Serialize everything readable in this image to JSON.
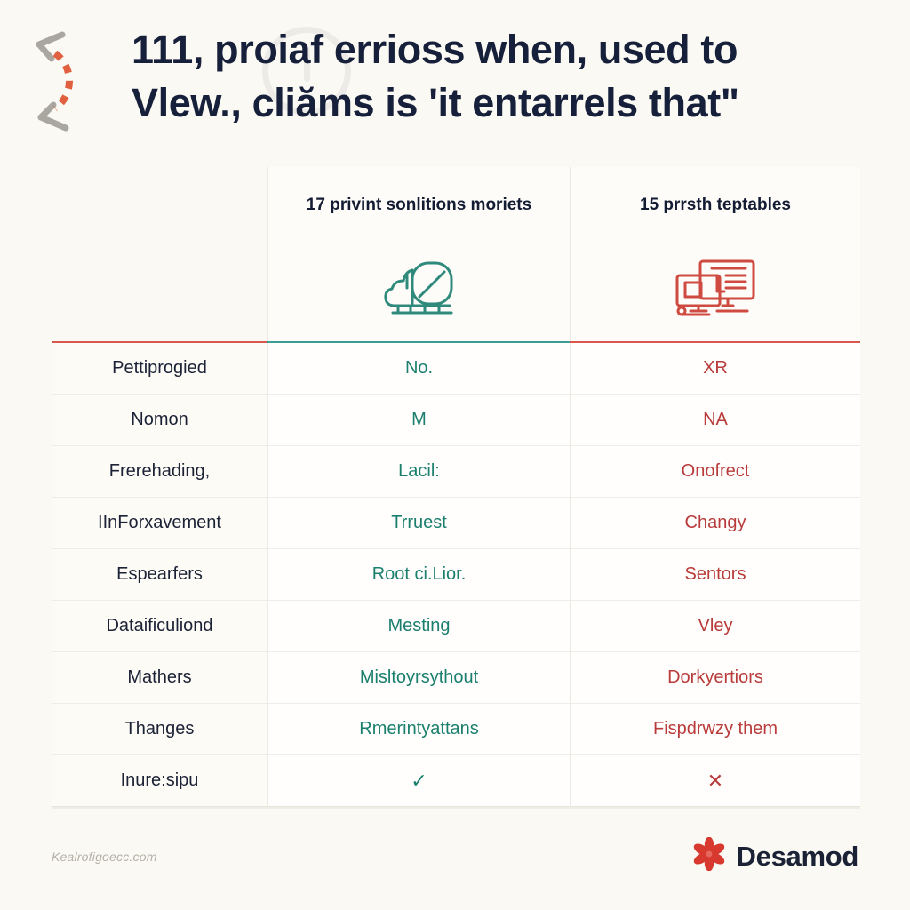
{
  "header": {
    "title_line_1": "111, proiaf errioss when, used to",
    "title_line_2": "Vlew., cliăms is 'it entarrels that\"",
    "decoration_icon": "dashed-arc-arrows-icon",
    "watermark_icon": "faint-circle-watermark-icon"
  },
  "table": {
    "columns": [
      {
        "label": "",
        "icon": ""
      },
      {
        "label": "17 privint sonlitions moriets",
        "icon": "teal-lineart-object-icon",
        "accent": "#3a9e93"
      },
      {
        "label": "15 prrsth teptables",
        "icon": "red-lineart-monitors-icon",
        "accent": "#d9574c"
      }
    ],
    "rows": [
      {
        "label": "Pettiprogied",
        "a": "No.",
        "b": "XR"
      },
      {
        "label": "Nomon",
        "a": "M",
        "b": "NA"
      },
      {
        "label": "Frerehading,",
        "a": "Lacil:",
        "b": "Onofrect"
      },
      {
        "label": "IInForxavement",
        "a": "Trruest",
        "b": "Changy"
      },
      {
        "label": "Espearfers",
        "a": "Root ci.Lior.",
        "b": "Sentors"
      },
      {
        "label": "Dataificuliond",
        "a": "Mesting",
        "b": "Vley"
      },
      {
        "label": "Mathers",
        "a": "Misltoyrsythout",
        "b": "Dorkyertiors"
      },
      {
        "label": "Thanges",
        "a": "Rmerintyattans",
        "b": "Fispdrwzy them"
      },
      {
        "label": "Inure:sipu",
        "a": "✓",
        "b": "✕"
      }
    ]
  },
  "footer": {
    "source": "Kealrofigoecc.com",
    "brand_name": "Desamod",
    "brand_icon": "red-flower-logo-icon"
  },
  "colors": {
    "page_background": "#fbf9f3",
    "title_text": "#17203a",
    "column_a_text": "#1b7f6e",
    "column_b_text": "#b93b3b",
    "accent_red": "#d9574c",
    "accent_teal": "#3a9e93",
    "brand_red": "#d8392f"
  }
}
